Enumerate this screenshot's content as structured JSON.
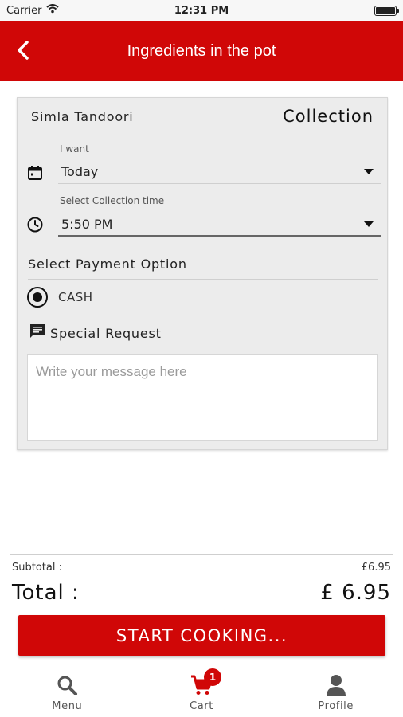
{
  "status_bar": {
    "carrier": "Carrier",
    "time": "12:31 PM"
  },
  "header": {
    "title": "Ingredients in the pot",
    "back_icon": "chevron-left-icon"
  },
  "order": {
    "restaurant_name": "Simla Tandoori",
    "order_type": "Collection",
    "date_field": {
      "label": "I want",
      "value": "Today",
      "icon": "calendar-icon"
    },
    "time_field": {
      "label": "Select Collection time",
      "value": "5:50 PM",
      "icon": "clock-icon"
    },
    "payment": {
      "title": "Select Payment Option",
      "selected_option": "CASH"
    },
    "special_request": {
      "label": "Special Request",
      "placeholder": "Write your message here",
      "icon": "message-icon"
    }
  },
  "totals": {
    "subtotal_label": "Subtotal :",
    "subtotal_value": "£6.95",
    "total_label": "Total :",
    "total_value": "£ 6.95"
  },
  "cta": {
    "label": "START COOKING..."
  },
  "tabbar": {
    "items": [
      {
        "label": "Menu",
        "icon": "search-icon"
      },
      {
        "label": "Cart",
        "icon": "cart-icon",
        "badge": "1"
      },
      {
        "label": "Profile",
        "icon": "user-icon"
      }
    ]
  },
  "colors": {
    "brand": "#d00707",
    "card_background": "#ececec"
  }
}
